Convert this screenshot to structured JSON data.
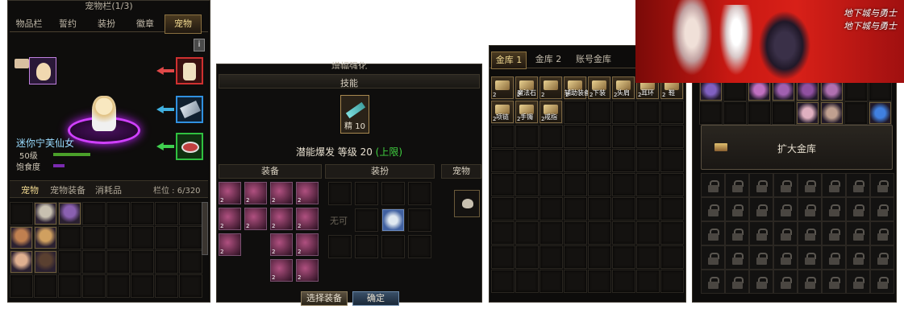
{
  "pet_panel": {
    "title": "宠物栏(1/3)",
    "tabs": [
      "物品栏",
      "誓约",
      "装扮",
      "徽章",
      "宠物"
    ],
    "active_tab": "宠物",
    "info_btn": "i",
    "pet_name": "迷你宁芙仙女",
    "level": "50级",
    "satiety_label": "饱食度",
    "subtabs": [
      "宠物",
      "宠物装备",
      "消耗品"
    ],
    "slot_count_label": "栏位 : 6/320",
    "colors": {
      "level_bar": "#4aa02a",
      "satiety_bar": "#7a2ab0",
      "pet_name": "#9adcff"
    }
  },
  "enhance_panel": {
    "title": "增幅强化",
    "skill_label": "技能",
    "skill_item_label": "精 10",
    "potential_text": "潜能爆发 等级 20",
    "potential_limit": "(上限)",
    "col_equip": "装备",
    "col_avatar": "装扮",
    "col_pet": "宠物",
    "empty_slot_label": "无可",
    "btn_select": "选择装备",
    "btn_confirm": "确定"
  },
  "bank_panel": {
    "tabs": [
      "金库 1",
      "金库 2",
      "账号金库"
    ],
    "items": [
      "",
      "魔法石",
      "",
      "辅助装备",
      "下装",
      "头肩",
      "耳环",
      "鞋",
      "项链",
      "手镯",
      "戒指"
    ]
  },
  "account_bank": {
    "expand_label": "扩大金库"
  },
  "banner": {
    "logo_text": "地下城与勇士"
  }
}
